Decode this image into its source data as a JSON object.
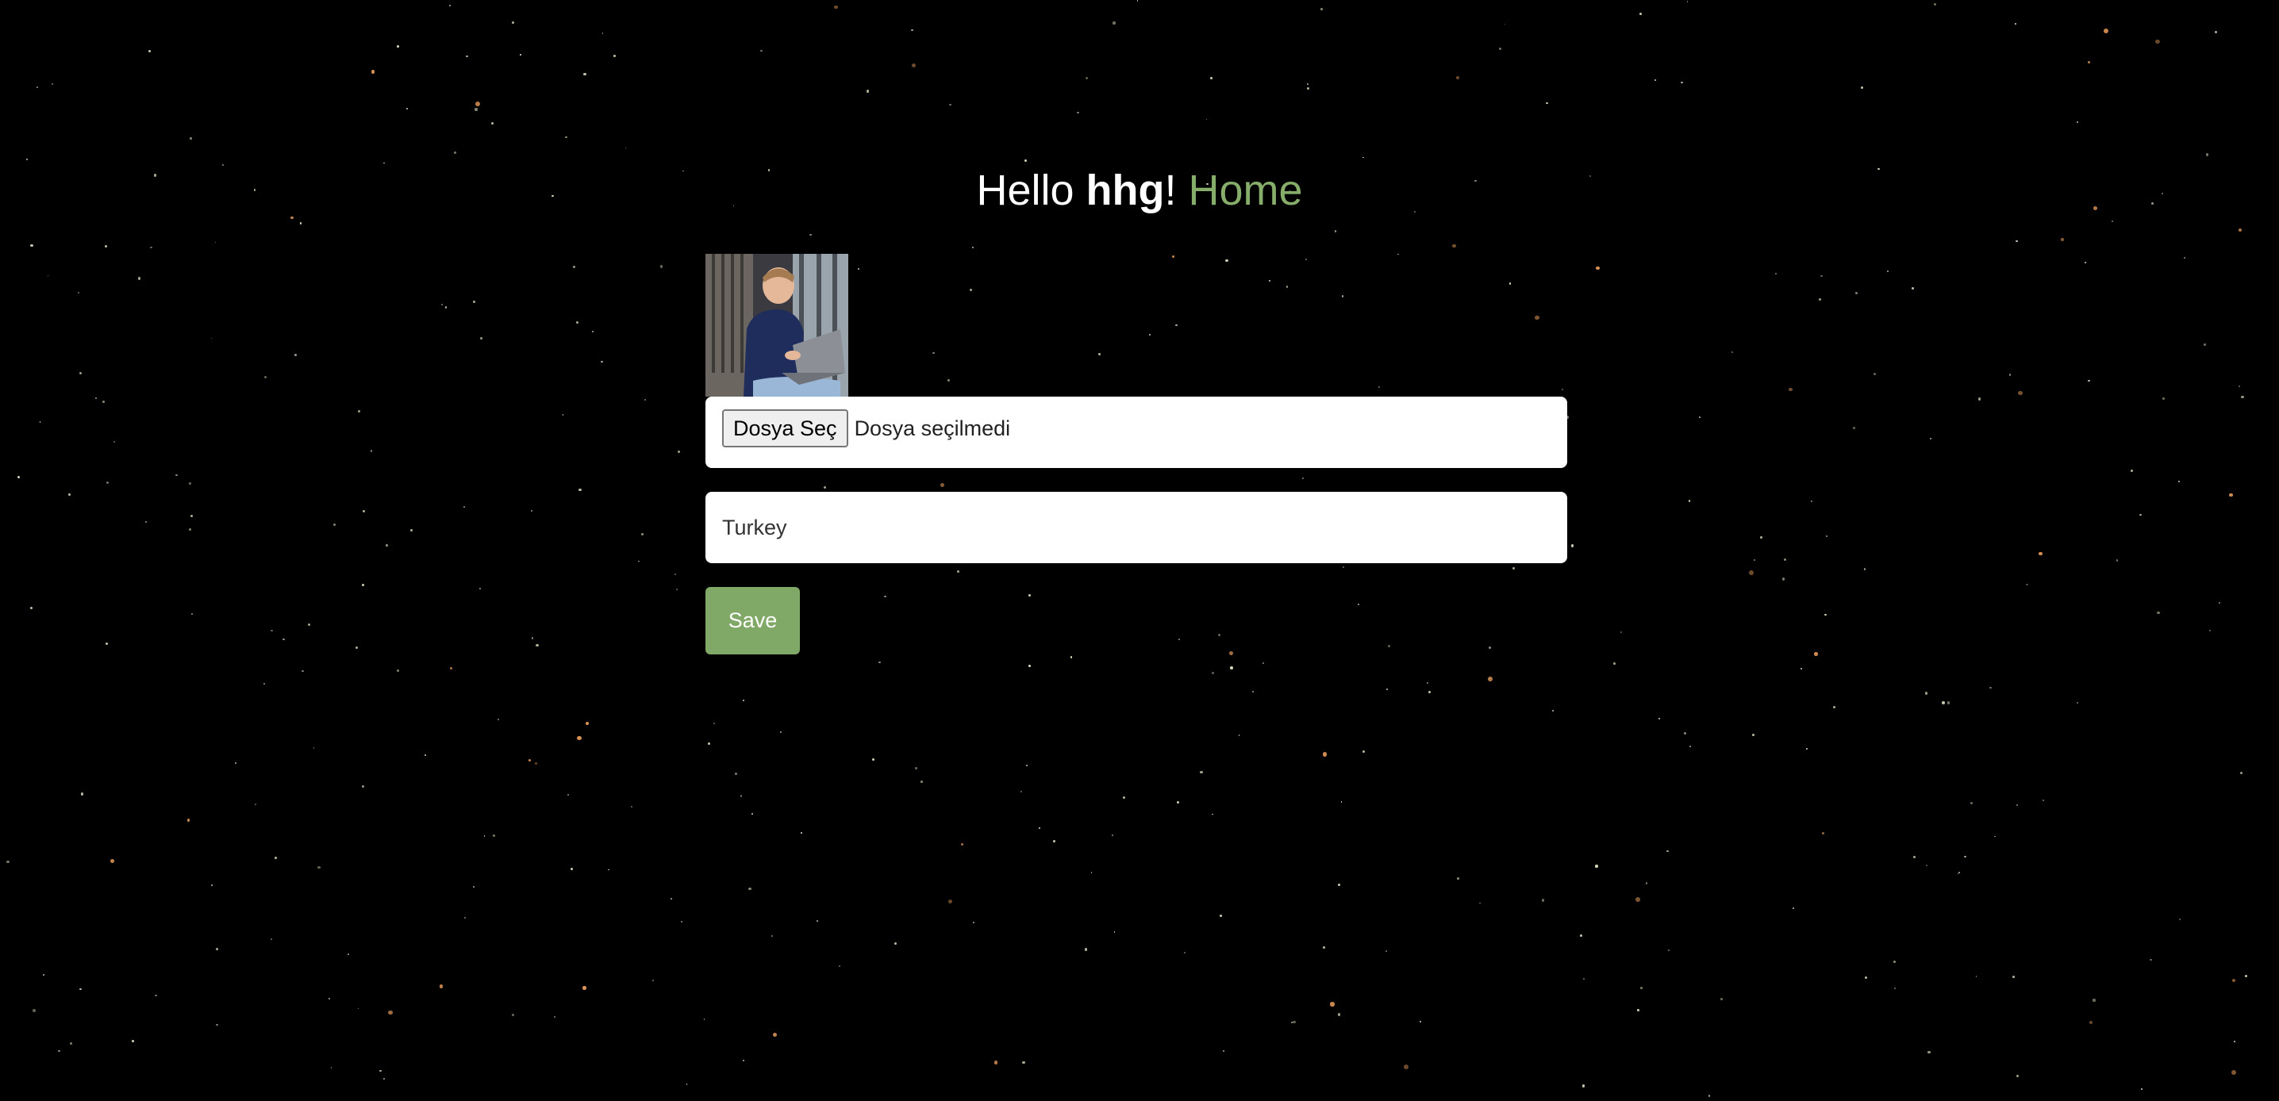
{
  "header": {
    "hello": "Hello ",
    "username": "hhg",
    "exclamation": "! ",
    "home_link": "Home"
  },
  "profile": {
    "avatar_icon": "profile-photo"
  },
  "file_input": {
    "button_label": "Dosya Seç",
    "status": "Dosya seçilmedi"
  },
  "country_input": {
    "value": "Turkey"
  },
  "actions": {
    "save_label": "Save"
  },
  "colors": {
    "background": "#000000",
    "accent": "#80a866",
    "link": "#86ad6a",
    "star_white": "#d6d6b8",
    "star_orange": "#e59a5a"
  }
}
